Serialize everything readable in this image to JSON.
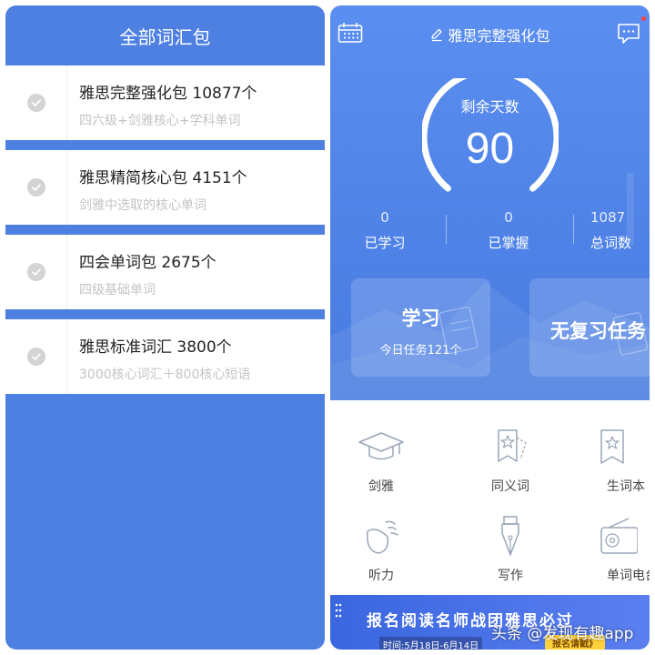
{
  "left": {
    "title": "全部词汇包",
    "packs": [
      {
        "title": "雅思完整强化包 10877个",
        "desc": "四六级+剑雅核心+学科单词"
      },
      {
        "title": "雅思精简核心包 4151个",
        "desc": "剑雅中选取的核心单词"
      },
      {
        "title": "四会单词包 2675个",
        "desc": "四级基础单词"
      },
      {
        "title": "雅思标准词汇 3800个",
        "desc": "3000核心词汇＋800核心短语"
      }
    ]
  },
  "right": {
    "title": "雅思完整强化包",
    "countdown": {
      "label": "剩余天数",
      "value": "90"
    },
    "stats": [
      {
        "num": "0",
        "label": "已学习"
      },
      {
        "num": "0",
        "label": "已掌握"
      },
      {
        "num": "1087",
        "label": "总词数"
      }
    ],
    "cards": {
      "study": {
        "title": "学习",
        "sub": "今日任务121个"
      },
      "review": {
        "title": "无复习任务"
      }
    },
    "features": [
      {
        "label": "剑雅",
        "icon": "graduation-cap-icon"
      },
      {
        "label": "同义词",
        "icon": "star-card-icon"
      },
      {
        "label": "生词本",
        "icon": "bookmark-star-icon"
      },
      {
        "label": "听力",
        "icon": "headphone-icon"
      },
      {
        "label": "写作",
        "icon": "pen-nib-icon"
      },
      {
        "label": "单词电台",
        "icon": "radio-icon"
      }
    ],
    "banner": {
      "text": "报名阅读名师战团雅思必过",
      "date": "时间:5月18日-6月14日",
      "button": "报名请戳》"
    }
  },
  "watermark": "头条 @发现有趣app",
  "colors": {
    "primary": "#4e80e2",
    "hero": "#5a8ef0",
    "banner_button": "#ffd23c"
  }
}
